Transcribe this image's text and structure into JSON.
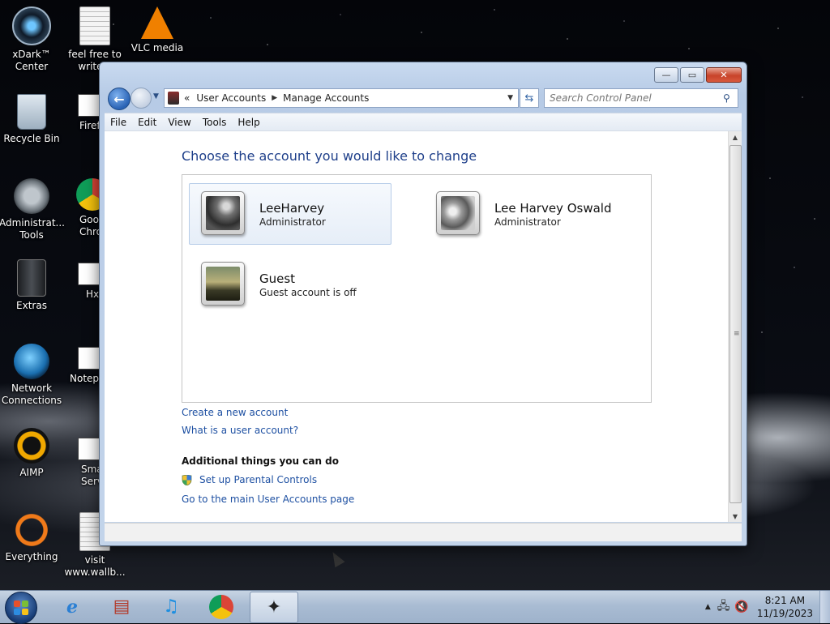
{
  "desktop": {
    "icons": [
      {
        "label": "xDark™ Center",
        "icon": "xdark-icon"
      },
      {
        "label": "feel free to write a",
        "icon": "text-document-icon"
      },
      {
        "label": "VLC media",
        "icon": "vlc-icon"
      },
      {
        "label": "Recycle Bin",
        "icon": "recycle-bin-icon"
      },
      {
        "label": "Firef",
        "icon": "firefox-icon"
      },
      {
        "label": "Administrat... Tools",
        "icon": "admin-tools-icon"
      },
      {
        "label": "Goog Chro",
        "icon": "chrome-icon"
      },
      {
        "label": "Extras",
        "icon": "folder-icon"
      },
      {
        "label": "Hxl",
        "icon": "app-icon"
      },
      {
        "label": "Network Connections",
        "icon": "network-icon"
      },
      {
        "label": "Notepa",
        "icon": "notepad-icon"
      },
      {
        "label": "AIMP",
        "icon": "aimp-icon"
      },
      {
        "label": "Sma Servi",
        "icon": "app-icon"
      },
      {
        "label": "Everything",
        "icon": "everything-icon"
      },
      {
        "label": "visit www.wallb...",
        "icon": "text-document-icon"
      }
    ]
  },
  "window": {
    "title": "Manage Accounts",
    "controls": {
      "minimize": "—",
      "maximize": "▭",
      "close": "✕"
    },
    "address": {
      "prefix": "«",
      "crumbs": [
        "User Accounts",
        "Manage Accounts"
      ],
      "separator": "▶",
      "dropdown": "▼"
    },
    "search": {
      "placeholder": "Search Control Panel",
      "value": ""
    },
    "menu": [
      "File",
      "Edit",
      "View",
      "Tools",
      "Help"
    ],
    "heading": "Choose the account you would like to change",
    "accounts": [
      {
        "name": "LeeHarvey",
        "role": "Administrator",
        "selected": true
      },
      {
        "name": "Lee Harvey Oswald",
        "role": "Administrator",
        "selected": false
      },
      {
        "name": "Guest",
        "role": "Guest account is off",
        "selected": false
      }
    ],
    "links": {
      "create": "Create a new account",
      "what_is": "What is a user account?",
      "additional_heading": "Additional things you can do",
      "parental": "Set up Parental Controls",
      "main_page": "Go to the main User Accounts page"
    }
  },
  "taskbar": {
    "items": [
      {
        "name": "internet-explorer-icon",
        "glyph": "e",
        "color": "#2a7fd4",
        "active": false
      },
      {
        "name": "app-window-icon",
        "glyph": "▤",
        "color": "#b33a2a",
        "active": false
      },
      {
        "name": "music-player-icon",
        "glyph": "♫",
        "color": "#1f8fe0",
        "active": false
      },
      {
        "name": "chrome-icon",
        "glyph": "◉",
        "color": "#d23b2d",
        "active": false
      },
      {
        "name": "control-panel-icon",
        "glyph": "✦",
        "color": "#222222",
        "active": true
      }
    ],
    "clock": {
      "time": "8:21 AM",
      "date": "11/19/2023"
    }
  }
}
